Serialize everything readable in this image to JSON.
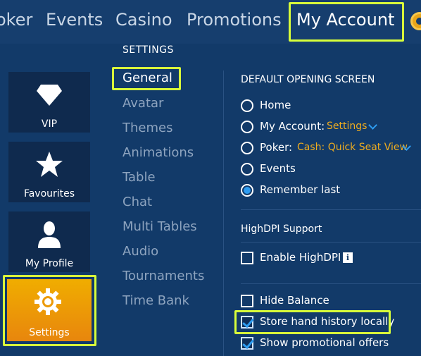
{
  "nav": {
    "items": [
      "oker",
      "Events",
      "Casino",
      "Promotions",
      "My Account"
    ],
    "active": "My Account"
  },
  "tiles": [
    {
      "label": "VIP",
      "icon": "diamond-icon"
    },
    {
      "label": "Favourites",
      "icon": "star-icon"
    },
    {
      "label": "My Profile",
      "icon": "person-icon"
    },
    {
      "label": "Settings",
      "icon": "gear-icon"
    }
  ],
  "settings_menu": {
    "title": "SETTINGS",
    "items": [
      "General",
      "Avatar",
      "Themes",
      "Animations",
      "Table",
      "Chat",
      "Multi Tables",
      "Audio",
      "Tournaments",
      "Time Bank"
    ],
    "active": "General"
  },
  "general": {
    "opening_screen_title": "DEFAULT OPENING SCREEN",
    "opening_options": [
      {
        "label": "Home",
        "checked": false
      },
      {
        "label": "My Account:",
        "value": "Settings",
        "checked": false
      },
      {
        "label": "Poker:",
        "value": "Cash: Quick Seat View",
        "checked": false
      },
      {
        "label": "Events",
        "checked": false
      },
      {
        "label": "Remember last",
        "checked": true
      }
    ],
    "highdpi_title": "HighDPI Support",
    "highdpi": {
      "label": "Enable HighDPI",
      "checked": false,
      "info_glyph": "i"
    },
    "other_options": [
      {
        "label": "Hide Balance",
        "checked": false
      },
      {
        "label": "Store hand history locally",
        "checked": true
      },
      {
        "label": "Show promotional offers",
        "checked": true
      }
    ]
  },
  "colors": {
    "background": "#123a69",
    "accent_orange": "#f0ad00",
    "highlight": "#d8ff3a",
    "link_value": "#f0ad1e",
    "check_blue": "#2e9cf0"
  }
}
